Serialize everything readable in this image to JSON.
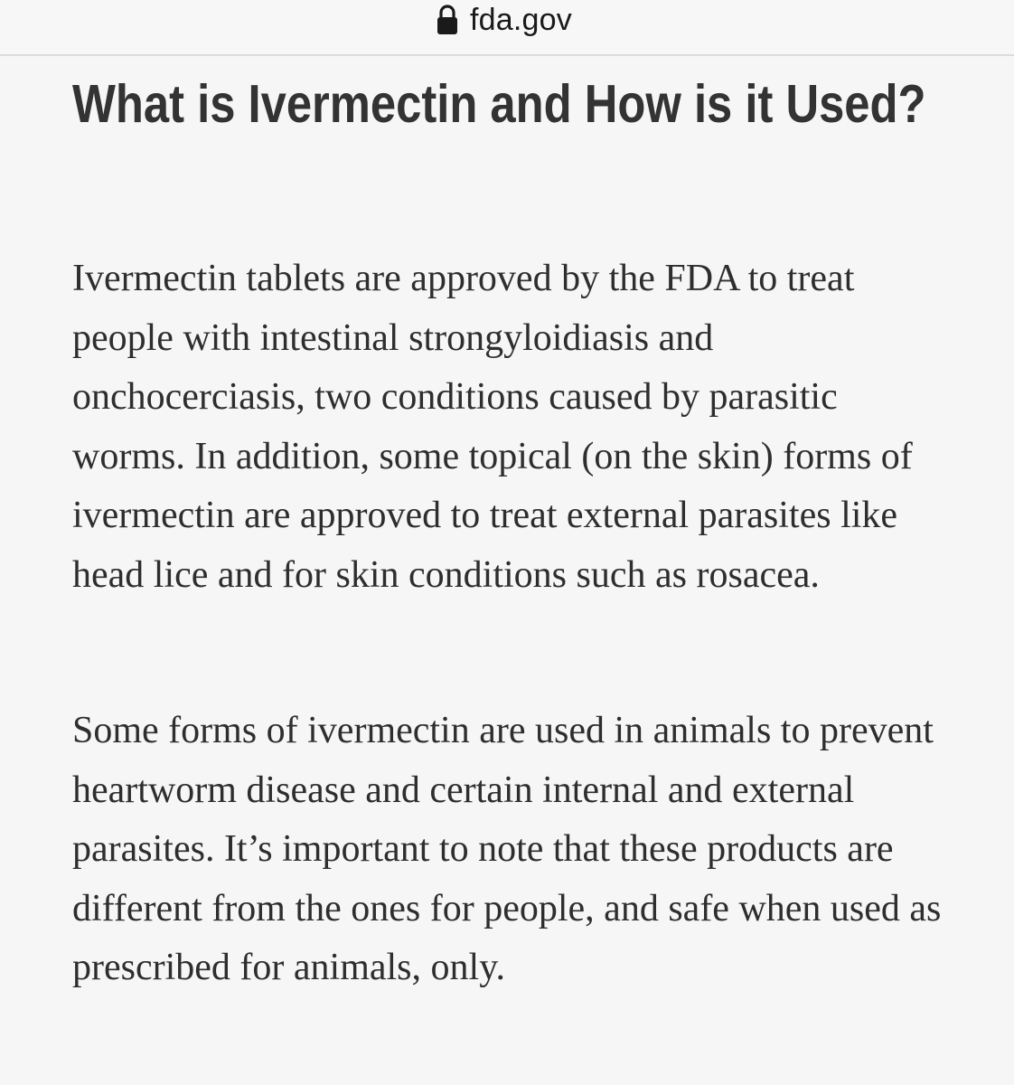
{
  "browser": {
    "url": "fda.gov",
    "lock_icon": "lock-icon"
  },
  "article": {
    "heading": "What is Ivermectin and How is it Used?",
    "paragraphs": [
      "Ivermectin tablets are approved by the FDA to treat people with intestinal strongyloidiasis and onchocerciasis, two conditions caused by parasitic worms. In addition, some topical (on the skin) forms of ivermectin are approved to treat external parasites like head lice and for skin conditions such as rosacea.",
      "Some forms of ivermectin are used in animals to prevent heartworm disease and certain internal and external parasites. It’s important to note that these products are different from the ones for people, and safe when used as prescribed for animals, only."
    ]
  }
}
